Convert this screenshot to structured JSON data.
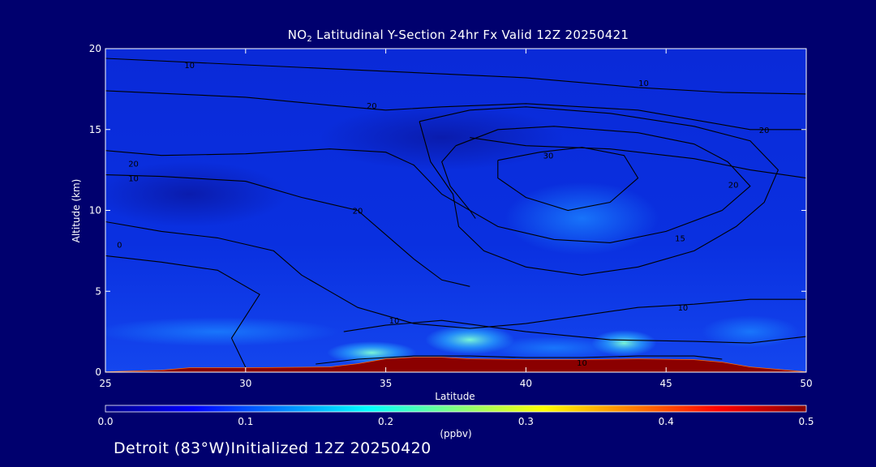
{
  "title_pre": "NO",
  "title_sub": "2",
  "title_post": " Latitudinal Y-Section 24hr  Fx Valid 12Z 20250421",
  "footer": "Detroit (83°W)Initialized 12Z 20250420",
  "colorbar_unit": "(ppbv)",
  "colors": {
    "background": "#00006e",
    "low": "#0000c8",
    "high": "#8b0000"
  },
  "chart_data": {
    "type": "heatmap",
    "xlabel": "Latitude",
    "ylabel": "Altitude (km)",
    "xlim": [
      25,
      50
    ],
    "ylim": [
      0,
      20
    ],
    "x_ticks": [
      "25",
      "30",
      "35",
      "40",
      "45",
      "50"
    ],
    "y_ticks": [
      "0",
      "5",
      "10",
      "15",
      "20"
    ],
    "colorbar": {
      "range": [
        0.0,
        0.5
      ],
      "ticks": [
        "0.0",
        "0.1",
        "0.2",
        "0.3",
        "0.4",
        "0.5"
      ],
      "colors": [
        "#00008b",
        "#0000ff",
        "#0080ff",
        "#00ffff",
        "#80ff80",
        "#ffff00",
        "#ff8000",
        "#ff0000",
        "#8b0000"
      ]
    },
    "surface_layer": {
      "lat": [
        25,
        27,
        28,
        30,
        33,
        34,
        35,
        36,
        37,
        38,
        40,
        42,
        44,
        46,
        47,
        48,
        50
      ],
      "alt_km": [
        0.0,
        0.1,
        0.25,
        0.25,
        0.3,
        0.5,
        0.8,
        0.9,
        0.9,
        0.8,
        0.75,
        0.75,
        0.8,
        0.75,
        0.6,
        0.3,
        0.0
      ],
      "value_ppbv": 0.5
    },
    "elevated_patches": [
      {
        "lat": 35.0,
        "alt_km": 1.2,
        "value_ppbv": 0.25
      },
      {
        "lat": 38.0,
        "alt_km": 2.0,
        "value_ppbv": 0.2
      },
      {
        "lat": 43.5,
        "alt_km": 1.8,
        "value_ppbv": 0.22
      },
      {
        "lat": 30.5,
        "alt_km": 2.5,
        "value_ppbv": 0.12
      },
      {
        "lat": 42.0,
        "alt_km": 9.5,
        "value_ppbv": 0.1
      }
    ],
    "contour_labels": [
      {
        "text": "10",
        "lat": 28.0,
        "alt_km": 19.0
      },
      {
        "text": "10",
        "lat": 44.2,
        "alt_km": 17.9
      },
      {
        "text": "20",
        "lat": 34.5,
        "alt_km": 16.5
      },
      {
        "text": "20",
        "lat": 48.5,
        "alt_km": 15.0
      },
      {
        "text": "20",
        "lat": 26.0,
        "alt_km": 12.9
      },
      {
        "text": "10",
        "lat": 26.0,
        "alt_km": 12.0
      },
      {
        "text": "30",
        "lat": 40.8,
        "alt_km": 13.4
      },
      {
        "text": "20",
        "lat": 47.4,
        "alt_km": 11.6
      },
      {
        "text": "20",
        "lat": 34.0,
        "alt_km": 10.0
      },
      {
        "text": "15",
        "lat": 45.5,
        "alt_km": 8.3
      },
      {
        "text": "0",
        "lat": 25.5,
        "alt_km": 7.9
      },
      {
        "text": "10",
        "lat": 45.6,
        "alt_km": 4.0
      },
      {
        "text": "10",
        "lat": 35.3,
        "alt_km": 3.2
      },
      {
        "text": "10",
        "lat": 42.0,
        "alt_km": 0.6
      }
    ],
    "contours": [
      [
        [
          25,
          19.4
        ],
        [
          30,
          19.0
        ],
        [
          35,
          18.6
        ],
        [
          40,
          18.2
        ],
        [
          44,
          17.6
        ],
        [
          47,
          17.3
        ],
        [
          50,
          17.2
        ]
      ],
      [
        [
          25,
          17.4
        ],
        [
          30,
          17.0
        ],
        [
          33,
          16.5
        ],
        [
          35,
          16.2
        ],
        [
          37,
          16.4
        ],
        [
          40,
          16.6
        ],
        [
          44,
          16.2
        ],
        [
          48,
          15.0
        ],
        [
          50,
          15.0
        ]
      ],
      [
        [
          38,
          14.5
        ],
        [
          40,
          14.0
        ],
        [
          43,
          13.8
        ],
        [
          46,
          13.2
        ],
        [
          48,
          12.5
        ],
        [
          50,
          12.0
        ]
      ],
      [
        [
          25,
          13.7
        ],
        [
          27,
          13.4
        ],
        [
          30,
          13.5
        ],
        [
          33,
          13.8
        ],
        [
          35,
          13.6
        ],
        [
          36,
          12.8
        ],
        [
          37,
          11.0
        ],
        [
          38,
          10.0
        ],
        [
          38.2,
          9.5
        ]
      ],
      [
        [
          25,
          12.2
        ],
        [
          27,
          12.1
        ],
        [
          30,
          11.8
        ],
        [
          32,
          10.8
        ],
        [
          34,
          10.0
        ],
        [
          35,
          8.5
        ],
        [
          36,
          7.0
        ],
        [
          37,
          5.7
        ],
        [
          38,
          5.3
        ]
      ],
      [
        [
          25,
          9.3
        ],
        [
          27,
          8.7
        ],
        [
          29,
          8.3
        ],
        [
          31,
          7.5
        ],
        [
          32,
          6.0
        ],
        [
          33,
          5.0
        ],
        [
          34,
          4.0
        ],
        [
          36,
          3.0
        ],
        [
          38,
          2.7
        ],
        [
          40,
          3.0
        ],
        [
          42,
          3.5
        ],
        [
          44,
          4.0
        ],
        [
          46,
          4.2
        ],
        [
          48,
          4.5
        ],
        [
          50,
          4.5
        ]
      ],
      [
        [
          25,
          7.2
        ],
        [
          27,
          6.8
        ],
        [
          29,
          6.3
        ],
        [
          30.5,
          4.8
        ],
        [
          29.5,
          2.1
        ],
        [
          30,
          0.3
        ]
      ],
      [
        [
          39,
          13.1
        ],
        [
          40.5,
          13.6
        ],
        [
          42,
          13.9
        ],
        [
          43.5,
          13.4
        ],
        [
          44,
          12.0
        ],
        [
          43,
          10.5
        ],
        [
          41.5,
          10.0
        ],
        [
          40,
          10.8
        ],
        [
          39,
          12.0
        ],
        [
          39,
          13.1
        ]
      ],
      [
        [
          37.5,
          14.0
        ],
        [
          39,
          15.0
        ],
        [
          41,
          15.2
        ],
        [
          44,
          14.8
        ],
        [
          46,
          14.1
        ],
        [
          47.2,
          13.0
        ],
        [
          48,
          11.5
        ],
        [
          47,
          10.0
        ],
        [
          45,
          8.7
        ],
        [
          43,
          8.0
        ],
        [
          41,
          8.2
        ],
        [
          39,
          9.0
        ],
        [
          38,
          10.0
        ],
        [
          37.3,
          11.5
        ],
        [
          37,
          13.0
        ],
        [
          37.5,
          14.0
        ]
      ],
      [
        [
          36.2,
          15.5
        ],
        [
          38,
          16.2
        ],
        [
          40,
          16.4
        ],
        [
          43,
          16.0
        ],
        [
          46,
          15.2
        ],
        [
          48,
          14.3
        ],
        [
          49,
          12.5
        ],
        [
          48.5,
          10.5
        ],
        [
          47.5,
          9.0
        ],
        [
          46,
          7.5
        ],
        [
          44,
          6.5
        ],
        [
          42,
          6.0
        ],
        [
          40,
          6.5
        ],
        [
          38.5,
          7.5
        ],
        [
          37.6,
          9.0
        ],
        [
          37.4,
          11.0
        ],
        [
          36.6,
          13.0
        ],
        [
          36.2,
          15.5
        ]
      ],
      [
        [
          33.5,
          2.5
        ],
        [
          35,
          2.9
        ],
        [
          37,
          3.2
        ],
        [
          40,
          2.5
        ],
        [
          43,
          2.0
        ],
        [
          46,
          1.9
        ],
        [
          48,
          1.8
        ],
        [
          50,
          2.2
        ]
      ],
      [
        [
          32.5,
          0.5
        ],
        [
          34,
          0.8
        ],
        [
          36,
          1.0
        ],
        [
          38,
          1.0
        ],
        [
          40,
          0.9
        ],
        [
          42,
          0.9
        ],
        [
          44,
          1.0
        ],
        [
          46,
          1.0
        ],
        [
          47,
          0.8
        ]
      ]
    ]
  }
}
